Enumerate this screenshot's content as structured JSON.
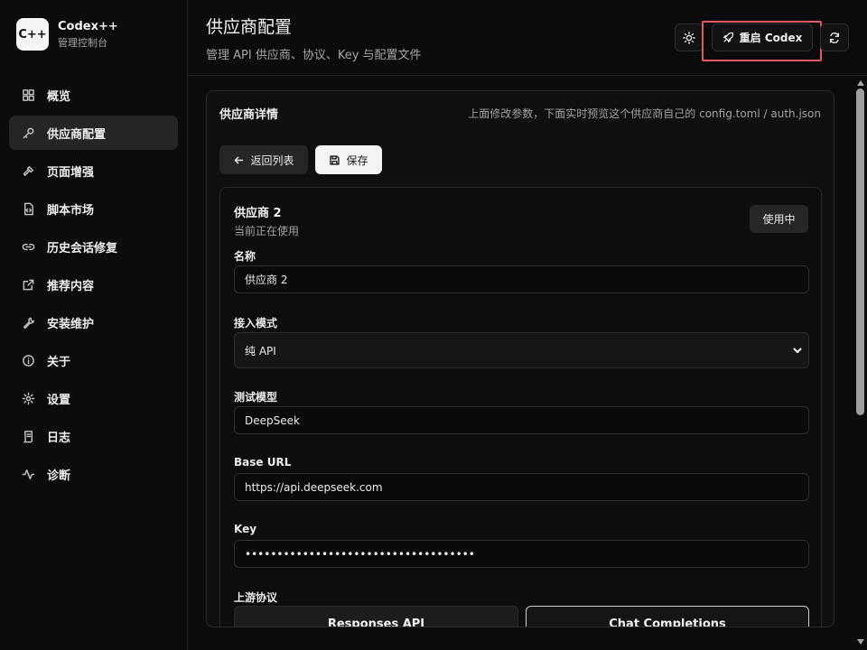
{
  "brand": {
    "logo": "C++",
    "name": "Codex++",
    "subtitle": "管理控制台"
  },
  "sidebar": {
    "items": [
      {
        "label": "概览",
        "icon": "grid-icon",
        "active": false
      },
      {
        "label": "供应商配置",
        "icon": "key-icon",
        "active": true
      },
      {
        "label": "页面增强",
        "icon": "hammer-icon",
        "active": false
      },
      {
        "label": "脚本市场",
        "icon": "file-code-icon",
        "active": false
      },
      {
        "label": "历史会话修复",
        "icon": "link-icon",
        "active": false
      },
      {
        "label": "推荐内容",
        "icon": "external-link-icon",
        "active": false
      },
      {
        "label": "安装维护",
        "icon": "wrench-icon",
        "active": false
      },
      {
        "label": "关于",
        "icon": "info-icon",
        "active": false
      },
      {
        "label": "设置",
        "icon": "gear-icon",
        "active": false
      },
      {
        "label": "日志",
        "icon": "scroll-icon",
        "active": false
      },
      {
        "label": "诊断",
        "icon": "activity-icon",
        "active": false
      }
    ]
  },
  "header": {
    "title": "供应商配置",
    "subtitle": "管理 API 供应商、协议、Key 与配置文件",
    "restart_label": "重启 Codex",
    "highlight_color": "#e05a60"
  },
  "panel": {
    "title": "供应商详情",
    "hint": "上面修改参数，下面实时预览这个供应商自己的 config.toml / auth.json",
    "back_label": "返回列表",
    "save_label": "保存"
  },
  "provider": {
    "title": "供应商 2",
    "subtitle": "当前正在使用",
    "status": "使用中",
    "fields": {
      "name_label": "名称",
      "name_value": "供应商 2",
      "mode_label": "接入模式",
      "mode_value": "纯 API",
      "model_label": "测试模型",
      "model_value": "DeepSeek",
      "base_url_label": "Base URL",
      "base_url_value": "https://api.deepseek.com",
      "key_label": "Key",
      "key_value": "••••••••••••••••••••••••••••••••••••",
      "protocol_label": "上游协议"
    },
    "protocols": [
      "Responses API",
      "Chat Completions"
    ],
    "selected_protocol": "Chat Completions"
  },
  "scrollbar": {
    "position": 0.0
  }
}
